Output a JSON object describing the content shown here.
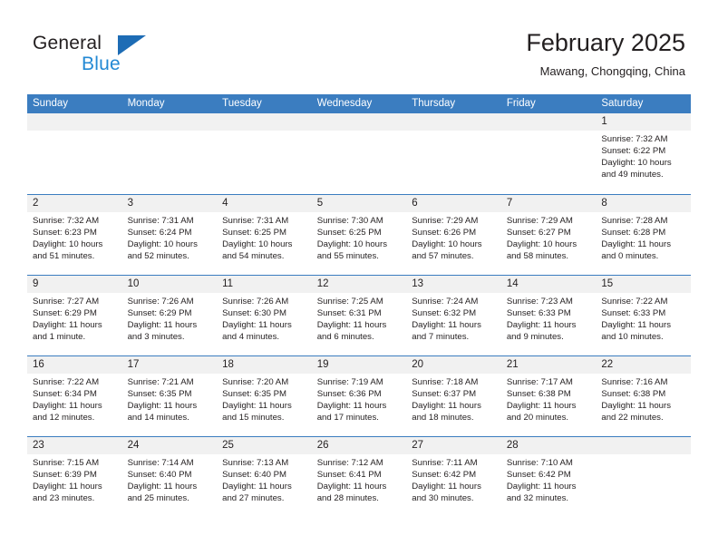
{
  "brand": {
    "word_one": "General",
    "word_two": "Blue",
    "triangle_color": "#1d6cb5",
    "blue_color": "#2389d4"
  },
  "header": {
    "title": "February 2025",
    "subtitle": "Mawang, Chongqing, China"
  },
  "theme": {
    "header_blue": "#3b7dc0",
    "date_band": "#f1f1f1",
    "text": "#231f20"
  },
  "calendar": {
    "weekday_headers": [
      "Sunday",
      "Monday",
      "Tuesday",
      "Wednesday",
      "Thursday",
      "Friday",
      "Saturday"
    ],
    "labels": {
      "sunrise": "Sunrise:",
      "sunset": "Sunset:",
      "daylight": "Daylight:"
    },
    "weeks": [
      [
        {
          "empty": true
        },
        {
          "empty": true
        },
        {
          "empty": true
        },
        {
          "empty": true
        },
        {
          "empty": true
        },
        {
          "empty": true
        },
        {
          "day": "1",
          "sunrise": "Sunrise: 7:32 AM",
          "sunset": "Sunset: 6:22 PM",
          "daylight_1": "Daylight: 10 hours",
          "daylight_2": "and 49 minutes."
        }
      ],
      [
        {
          "day": "2",
          "sunrise": "Sunrise: 7:32 AM",
          "sunset": "Sunset: 6:23 PM",
          "daylight_1": "Daylight: 10 hours",
          "daylight_2": "and 51 minutes."
        },
        {
          "day": "3",
          "sunrise": "Sunrise: 7:31 AM",
          "sunset": "Sunset: 6:24 PM",
          "daylight_1": "Daylight: 10 hours",
          "daylight_2": "and 52 minutes."
        },
        {
          "day": "4",
          "sunrise": "Sunrise: 7:31 AM",
          "sunset": "Sunset: 6:25 PM",
          "daylight_1": "Daylight: 10 hours",
          "daylight_2": "and 54 minutes."
        },
        {
          "day": "5",
          "sunrise": "Sunrise: 7:30 AM",
          "sunset": "Sunset: 6:25 PM",
          "daylight_1": "Daylight: 10 hours",
          "daylight_2": "and 55 minutes."
        },
        {
          "day": "6",
          "sunrise": "Sunrise: 7:29 AM",
          "sunset": "Sunset: 6:26 PM",
          "daylight_1": "Daylight: 10 hours",
          "daylight_2": "and 57 minutes."
        },
        {
          "day": "7",
          "sunrise": "Sunrise: 7:29 AM",
          "sunset": "Sunset: 6:27 PM",
          "daylight_1": "Daylight: 10 hours",
          "daylight_2": "and 58 minutes."
        },
        {
          "day": "8",
          "sunrise": "Sunrise: 7:28 AM",
          "sunset": "Sunset: 6:28 PM",
          "daylight_1": "Daylight: 11 hours",
          "daylight_2": "and 0 minutes."
        }
      ],
      [
        {
          "day": "9",
          "sunrise": "Sunrise: 7:27 AM",
          "sunset": "Sunset: 6:29 PM",
          "daylight_1": "Daylight: 11 hours",
          "daylight_2": "and 1 minute."
        },
        {
          "day": "10",
          "sunrise": "Sunrise: 7:26 AM",
          "sunset": "Sunset: 6:29 PM",
          "daylight_1": "Daylight: 11 hours",
          "daylight_2": "and 3 minutes."
        },
        {
          "day": "11",
          "sunrise": "Sunrise: 7:26 AM",
          "sunset": "Sunset: 6:30 PM",
          "daylight_1": "Daylight: 11 hours",
          "daylight_2": "and 4 minutes."
        },
        {
          "day": "12",
          "sunrise": "Sunrise: 7:25 AM",
          "sunset": "Sunset: 6:31 PM",
          "daylight_1": "Daylight: 11 hours",
          "daylight_2": "and 6 minutes."
        },
        {
          "day": "13",
          "sunrise": "Sunrise: 7:24 AM",
          "sunset": "Sunset: 6:32 PM",
          "daylight_1": "Daylight: 11 hours",
          "daylight_2": "and 7 minutes."
        },
        {
          "day": "14",
          "sunrise": "Sunrise: 7:23 AM",
          "sunset": "Sunset: 6:33 PM",
          "daylight_1": "Daylight: 11 hours",
          "daylight_2": "and 9 minutes."
        },
        {
          "day": "15",
          "sunrise": "Sunrise: 7:22 AM",
          "sunset": "Sunset: 6:33 PM",
          "daylight_1": "Daylight: 11 hours",
          "daylight_2": "and 10 minutes."
        }
      ],
      [
        {
          "day": "16",
          "sunrise": "Sunrise: 7:22 AM",
          "sunset": "Sunset: 6:34 PM",
          "daylight_1": "Daylight: 11 hours",
          "daylight_2": "and 12 minutes."
        },
        {
          "day": "17",
          "sunrise": "Sunrise: 7:21 AM",
          "sunset": "Sunset: 6:35 PM",
          "daylight_1": "Daylight: 11 hours",
          "daylight_2": "and 14 minutes."
        },
        {
          "day": "18",
          "sunrise": "Sunrise: 7:20 AM",
          "sunset": "Sunset: 6:35 PM",
          "daylight_1": "Daylight: 11 hours",
          "daylight_2": "and 15 minutes."
        },
        {
          "day": "19",
          "sunrise": "Sunrise: 7:19 AM",
          "sunset": "Sunset: 6:36 PM",
          "daylight_1": "Daylight: 11 hours",
          "daylight_2": "and 17 minutes."
        },
        {
          "day": "20",
          "sunrise": "Sunrise: 7:18 AM",
          "sunset": "Sunset: 6:37 PM",
          "daylight_1": "Daylight: 11 hours",
          "daylight_2": "and 18 minutes."
        },
        {
          "day": "21",
          "sunrise": "Sunrise: 7:17 AM",
          "sunset": "Sunset: 6:38 PM",
          "daylight_1": "Daylight: 11 hours",
          "daylight_2": "and 20 minutes."
        },
        {
          "day": "22",
          "sunrise": "Sunrise: 7:16 AM",
          "sunset": "Sunset: 6:38 PM",
          "daylight_1": "Daylight: 11 hours",
          "daylight_2": "and 22 minutes."
        }
      ],
      [
        {
          "day": "23",
          "sunrise": "Sunrise: 7:15 AM",
          "sunset": "Sunset: 6:39 PM",
          "daylight_1": "Daylight: 11 hours",
          "daylight_2": "and 23 minutes."
        },
        {
          "day": "24",
          "sunrise": "Sunrise: 7:14 AM",
          "sunset": "Sunset: 6:40 PM",
          "daylight_1": "Daylight: 11 hours",
          "daylight_2": "and 25 minutes."
        },
        {
          "day": "25",
          "sunrise": "Sunrise: 7:13 AM",
          "sunset": "Sunset: 6:40 PM",
          "daylight_1": "Daylight: 11 hours",
          "daylight_2": "and 27 minutes."
        },
        {
          "day": "26",
          "sunrise": "Sunrise: 7:12 AM",
          "sunset": "Sunset: 6:41 PM",
          "daylight_1": "Daylight: 11 hours",
          "daylight_2": "and 28 minutes."
        },
        {
          "day": "27",
          "sunrise": "Sunrise: 7:11 AM",
          "sunset": "Sunset: 6:42 PM",
          "daylight_1": "Daylight: 11 hours",
          "daylight_2": "and 30 minutes."
        },
        {
          "day": "28",
          "sunrise": "Sunrise: 7:10 AM",
          "sunset": "Sunset: 6:42 PM",
          "daylight_1": "Daylight: 11 hours",
          "daylight_2": "and 32 minutes."
        },
        {
          "empty": true
        }
      ]
    ]
  }
}
